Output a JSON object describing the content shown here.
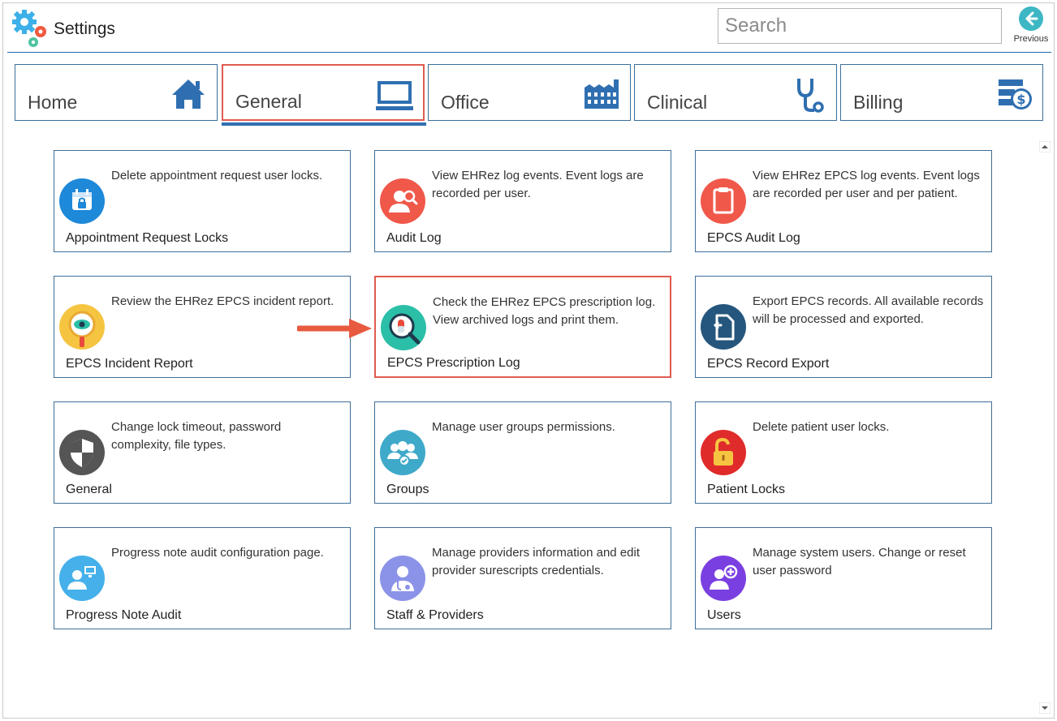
{
  "app": {
    "title": "Settings",
    "logo_icon": "gears-logo-icon"
  },
  "search": {
    "placeholder": "Search",
    "value": ""
  },
  "previous": {
    "label": "Previous",
    "icon": "arrow-left-circle-icon",
    "color": "#3db7c4"
  },
  "tabs": [
    {
      "label": "Home",
      "icon": "house-icon",
      "selected": false
    },
    {
      "label": "General",
      "icon": "monitor-icon",
      "selected": true
    },
    {
      "label": "Office",
      "icon": "factory-icon",
      "selected": false
    },
    {
      "label": "Clinical",
      "icon": "stethoscope-icon",
      "selected": false
    },
    {
      "label": "Billing",
      "icon": "billing-dollar-icon",
      "selected": false
    }
  ],
  "tiles": [
    {
      "title": "Appointment Request Locks",
      "desc": "Delete appointment request user locks.",
      "icon": "calendar-lock-icon",
      "color": "#1e88d9"
    },
    {
      "title": "Audit Log",
      "desc": "View EHRez log events. Event logs are recorded per user.",
      "icon": "user-search-icon",
      "color": "#f0584a"
    },
    {
      "title": "EPCS Audit Log",
      "desc": "View EHRez EPCS log events. Event logs are recorded per user and per patient.",
      "icon": "clipboard-icon",
      "color": "#f0584a"
    },
    {
      "title": "EPCS Incident Report",
      "desc": "Review the EHRez EPCS incident report.",
      "icon": "magnifier-eye-icon",
      "color": "#f5c542"
    },
    {
      "title": "EPCS Prescription Log",
      "desc": "Check the EHRez EPCS prescription log. View archived logs and print them.",
      "icon": "pill-search-icon",
      "color": "#2bbfa7"
    },
    {
      "title": "EPCS Record Export",
      "desc": "Export EPCS records. All available records will be processed and exported.",
      "icon": "document-export-icon",
      "color": "#25567d"
    },
    {
      "title": "General",
      "desc": "Change lock timeout, password complexity, file types.",
      "icon": "shield-icon",
      "color": "#555555"
    },
    {
      "title": "Groups",
      "desc": "Manage user groups permissions.",
      "icon": "user-group-icon",
      "color": "#3fa9c9"
    },
    {
      "title": "Patient Locks",
      "desc": "Delete patient user locks.",
      "icon": "unlock-icon",
      "color": "#e02b2b"
    },
    {
      "title": "Progress Note Audit",
      "desc": "Progress note audit configuration page.",
      "icon": "user-monitor-icon",
      "color": "#45b0ea"
    },
    {
      "title": "Staff & Providers",
      "desc": "Manage providers information and edit provider surescripts credentials.",
      "icon": "provider-stethoscope-icon",
      "color": "#8b93e8"
    },
    {
      "title": "Users",
      "desc": "Manage system users. Change or reset user password",
      "icon": "user-add-icon",
      "color": "#7a3fe0"
    }
  ],
  "colors": {
    "accent": "#2f6fb1",
    "highlight": "#e05b4f",
    "tile_border": "#3f6f98"
  }
}
